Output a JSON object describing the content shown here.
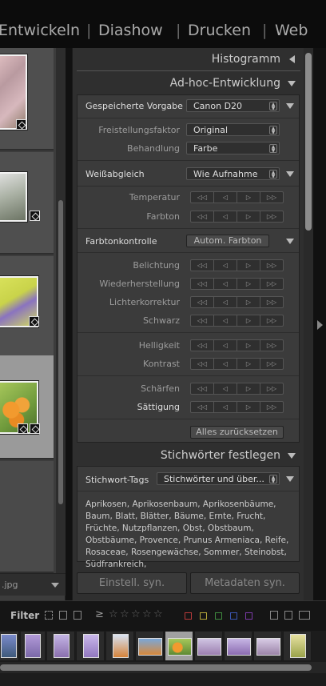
{
  "modules": [
    "Entwickeln",
    "Diashow",
    "Drucken",
    "Web"
  ],
  "separator": "|",
  "left_panel": {
    "filename": ".jpg"
  },
  "histogram": {
    "title": "Histogramm"
  },
  "quick_develop": {
    "title": "Ad-hoc-Entwicklung",
    "saved_preset": {
      "label": "Gespeicherte Vorgabe",
      "value": "Canon D20"
    },
    "crop_ratio": {
      "label": "Freistellungsfaktor",
      "value": "Original"
    },
    "treatment": {
      "label": "Behandlung",
      "value": "Farbe"
    },
    "white_balance": {
      "label": "Weißabgleich",
      "value": "Wie Aufnahme",
      "controls": [
        "Temperatur",
        "Farbton"
      ]
    },
    "tone_control": {
      "label": "Farbtonkontrolle",
      "auto_button": "Autom. Farbton",
      "controls": [
        "Belichtung",
        "Wiederherstellung",
        "Lichterkorrektur",
        "Schwarz"
      ],
      "controls2": [
        "Helligkeit",
        "Kontrast"
      ],
      "controls3": [
        "Schärfen",
        "Sättigung"
      ]
    },
    "stepper_glyphs": [
      "◁◁",
      "◁",
      "▷",
      "▷▷"
    ],
    "reset_button": "Alles zurücksetzen"
  },
  "keywording": {
    "title": "Stichwörter festlegen",
    "tags_label": "Stichwort-Tags",
    "tags_select": "Stichwörter und über...",
    "keywords": "Aprikosen, Aprikosenbaum, Aprikosenbäume, Baum, Blatt, Blätter, Bäume, Ernte, Frucht, Früchte, Nutzpflanzen, Obst, Obstbaum, Obstbäume, Provence, Prunus Armeniaca, Reife, Rosaceae, Rosengewächse, Sommer, Steinobst, Südfrankreich,"
  },
  "bottom_buttons": {
    "sync_settings": "Einstell. syn.",
    "sync_metadata": "Metadaten syn."
  },
  "filter_bar": {
    "label": "Filter",
    "gte": "≥",
    "stars": "☆",
    "colors": [
      "#b83a3a",
      "#b5a73a",
      "#3f8a3f",
      "#3a55b0",
      "#7b3aa8"
    ]
  },
  "icons": {
    "panel_collapsed": "triangle-left",
    "panel_expanded": "triangle-down"
  }
}
